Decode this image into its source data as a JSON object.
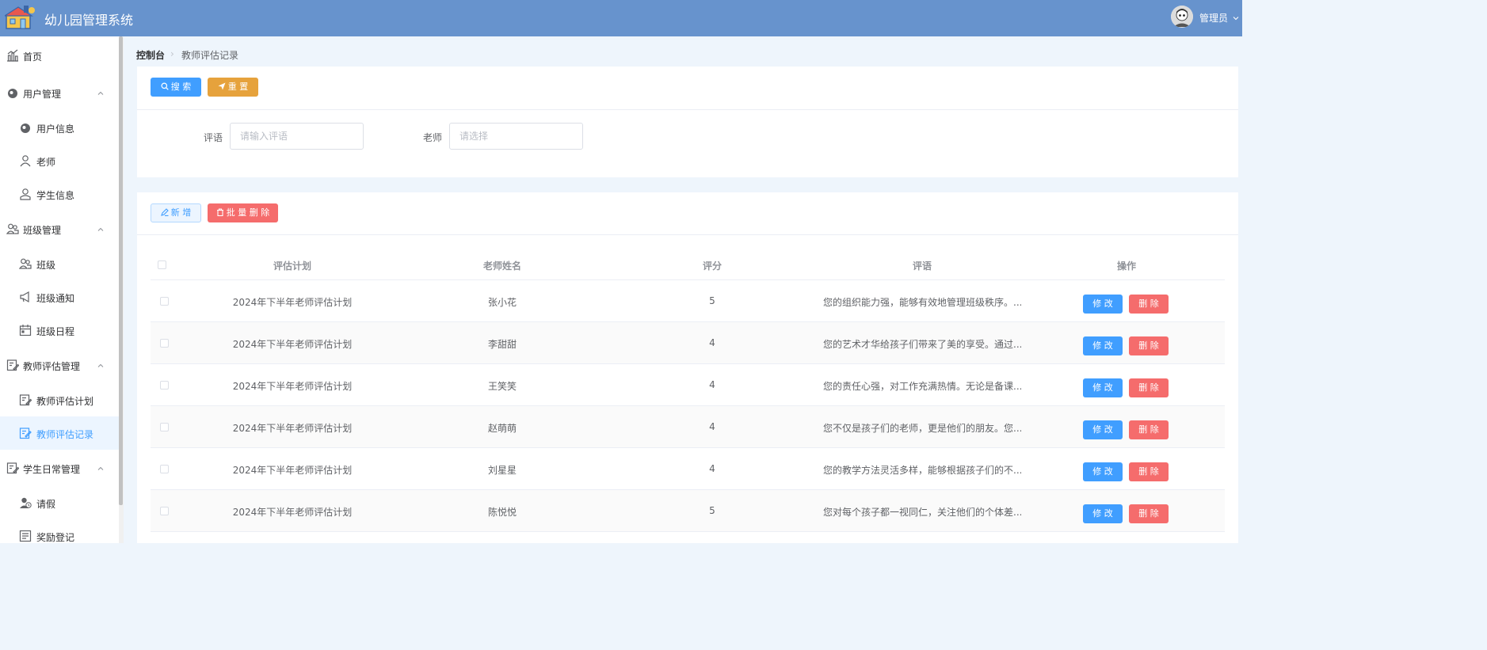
{
  "app": {
    "title": "幼儿园管理系统"
  },
  "user": {
    "name": "管理员"
  },
  "sidebar": {
    "items": [
      {
        "label": "首页",
        "icon": "chart-icon"
      },
      {
        "label": "用户管理",
        "icon": "user-group-icon"
      },
      {
        "label": "用户信息",
        "icon": "user-info-icon"
      },
      {
        "label": "老师",
        "icon": "teacher-icon"
      },
      {
        "label": "学生信息",
        "icon": "student-icon"
      },
      {
        "label": "班级管理",
        "icon": "class-manage-icon"
      },
      {
        "label": "班级",
        "icon": "class-icon"
      },
      {
        "label": "班级通知",
        "icon": "megaphone-icon"
      },
      {
        "label": "班级日程",
        "icon": "calendar-icon"
      },
      {
        "label": "教师评估管理",
        "icon": "evaluation-manage-icon"
      },
      {
        "label": "教师评估计划",
        "icon": "evaluation-plan-icon"
      },
      {
        "label": "教师评估记录",
        "icon": "edit-doc-icon"
      },
      {
        "label": "学生日常管理",
        "icon": "daily-manage-icon"
      },
      {
        "label": "请假",
        "icon": "leave-icon"
      },
      {
        "label": "奖励登记",
        "icon": "reward-icon"
      }
    ]
  },
  "breadcrumb": {
    "root": "控制台",
    "current": "教师评估记录"
  },
  "search": {
    "search_label": "搜 索",
    "reset_label": "重 置",
    "comment_label": "评语",
    "comment_placeholder": "请输入评语",
    "teacher_label": "老师",
    "teacher_placeholder": "请选择"
  },
  "toolbar": {
    "add_label": "新 增",
    "batch_delete_label": "批 量 删 除"
  },
  "table": {
    "headers": [
      "评估计划",
      "老师姓名",
      "评分",
      "评语",
      "操作"
    ],
    "edit_label": "修 改",
    "delete_label": "删 除",
    "rows": [
      {
        "plan": "2024年下半年老师评估计划",
        "teacher": "张小花",
        "score": "5",
        "comment": "您的组织能力强，能够有效地管理班级秩序。..."
      },
      {
        "plan": "2024年下半年老师评估计划",
        "teacher": "李甜甜",
        "score": "4",
        "comment": "您的艺术才华给孩子们带来了美的享受。通过..."
      },
      {
        "plan": "2024年下半年老师评估计划",
        "teacher": "王笑笑",
        "score": "4",
        "comment": "您的责任心强，对工作充满热情。无论是备课..."
      },
      {
        "plan": "2024年下半年老师评估计划",
        "teacher": "赵萌萌",
        "score": "4",
        "comment": "您不仅是孩子们的老师，更是他们的朋友。您..."
      },
      {
        "plan": "2024年下半年老师评估计划",
        "teacher": "刘星星",
        "score": "4",
        "comment": "您的教学方法灵活多样，能够根据孩子们的不..."
      },
      {
        "plan": "2024年下半年老师评估计划",
        "teacher": "陈悦悦",
        "score": "5",
        "comment": "您对每个孩子都一视同仁，关注他们的个体差..."
      }
    ]
  },
  "colors": {
    "header": "#6793cd",
    "primary": "#409eff",
    "warning": "#e6a23c",
    "danger": "#f56c6c"
  }
}
